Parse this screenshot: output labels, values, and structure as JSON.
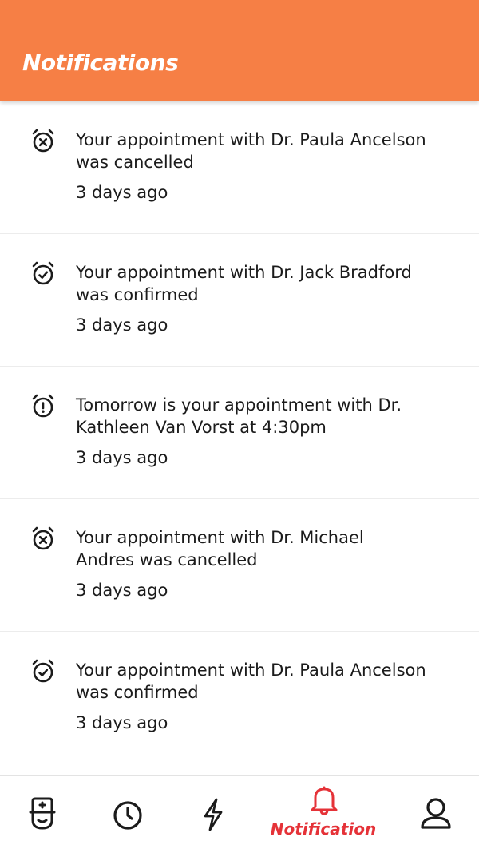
{
  "header": {
    "title": "Notifications"
  },
  "colors": {
    "accent": "#f67f45",
    "active": "#e53238",
    "icon": "#1b1b1b"
  },
  "notifications": [
    {
      "icon": "alarm-cancel-icon",
      "message": "Your appointment with Dr. Paula Ancelson was cancelled",
      "time": "3 days ago"
    },
    {
      "icon": "alarm-check-icon",
      "message": "Your appointment with Dr. Jack Bradford was confirmed",
      "time": "3 days ago"
    },
    {
      "icon": "alarm-alert-icon",
      "message": "Tomorrow is your appointment with Dr. Kathleen Van Vorst at 4:30pm",
      "time": "3 days ago"
    },
    {
      "icon": "alarm-cancel-icon",
      "message": "Your appointment with Dr. Michael Andres was cancelled",
      "time": "3 days ago"
    },
    {
      "icon": "alarm-check-icon",
      "message": "Your appointment with Dr. Paula Ancelson was confirmed",
      "time": "3 days ago"
    }
  ],
  "bottom_nav": {
    "items": [
      {
        "icon": "nurse-icon"
      },
      {
        "icon": "clock-icon"
      },
      {
        "icon": "lightning-icon"
      },
      {
        "icon": "bell-icon",
        "label": "Notification",
        "active": true
      },
      {
        "icon": "user-icon"
      }
    ]
  }
}
